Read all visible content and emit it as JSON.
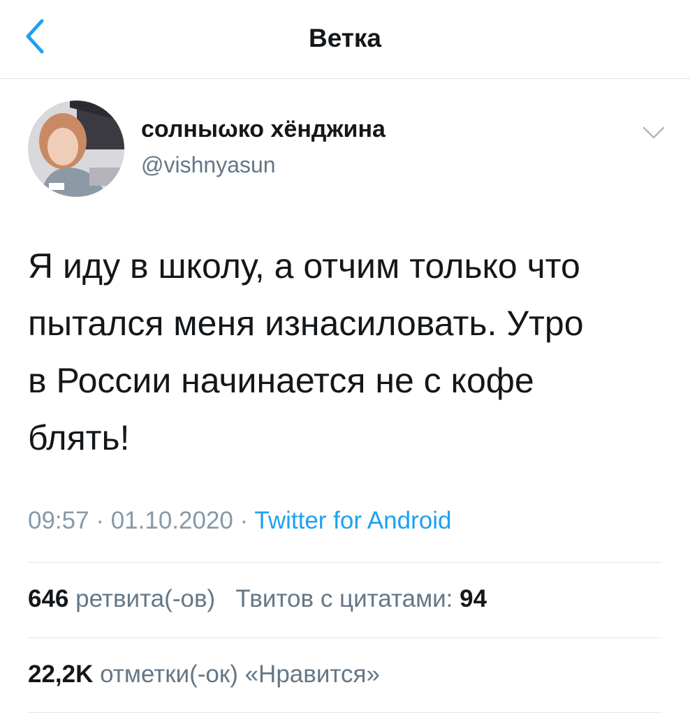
{
  "header": {
    "title": "Ветка",
    "back_icon": "chevron-left-icon",
    "accent_color": "#1da1f2"
  },
  "tweet": {
    "author": {
      "display_name": "солныωко хёнджина",
      "handle": "@vishnyasun",
      "avatar_icon": "user-avatar-photo"
    },
    "more_icon": "chevron-down-icon",
    "text": "Я иду в школу, а отчим только что\nпытался меня изнасиловать. Утро\nв России начинается не с кофе\nблять!",
    "time": "09:57",
    "date": "01.10.2020",
    "separator": "·",
    "source": "Twitter for Android"
  },
  "stats": {
    "retweets_count": "646",
    "retweets_label": "ретвита(-ов)",
    "quotes_label": "Твитов с цитатами:",
    "quotes_count": "94",
    "likes_count": "22,2K",
    "likes_label": "отметки(-ок) «Нравится»"
  },
  "colors": {
    "text_primary": "#14171a",
    "text_secondary": "#657786",
    "meta_gray": "#8899a6",
    "link_blue": "#1da1f2",
    "divider": "#e1e8ed"
  }
}
